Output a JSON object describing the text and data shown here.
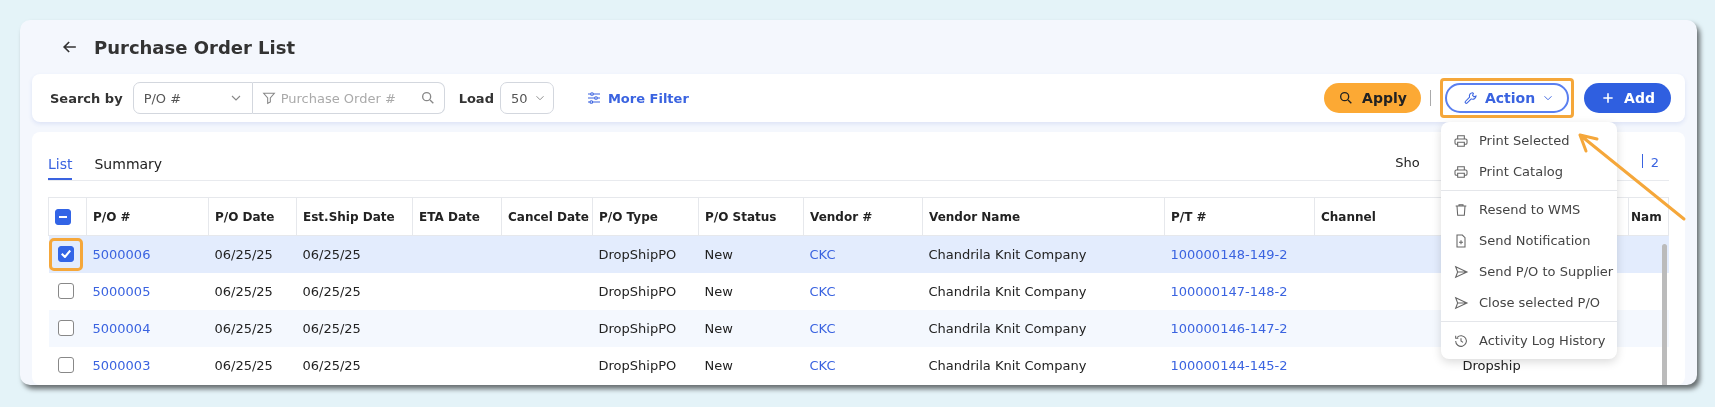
{
  "page": {
    "title": "Purchase Order List"
  },
  "toolbar": {
    "search_by_label": "Search by",
    "search_by": {
      "value": "P/O #"
    },
    "search_input": {
      "placeholder": "Purchase Order #"
    },
    "load_label": "Load",
    "load": {
      "value": "50"
    },
    "more_filter": "More Filter",
    "apply": "Apply",
    "action": {
      "label": "Action",
      "highlighted": true
    },
    "add": "Add"
  },
  "tabs": [
    {
      "label": "List",
      "selected": true
    },
    {
      "label": "Summary",
      "selected": false
    }
  ],
  "pagination": {
    "text": "Sho",
    "page": "2"
  },
  "action_menu": {
    "groups": [
      {
        "items": [
          {
            "kind": "print",
            "label": "Print Selected"
          },
          {
            "kind": "print",
            "label": "Print Catalog"
          }
        ]
      },
      {
        "items": [
          {
            "kind": "trash",
            "label": "Resend to WMS"
          },
          {
            "kind": "file",
            "label": "Send Notification"
          },
          {
            "kind": "send",
            "label": "Send P/O to Supplier"
          },
          {
            "kind": "send",
            "label": "Close selected P/O"
          }
        ]
      },
      {
        "items": [
          {
            "kind": "history",
            "label": "Activity Log History"
          }
        ]
      }
    ]
  },
  "table": {
    "select_all": {
      "checked": true,
      "indeterminate": true
    },
    "columns": [
      "P/O #",
      "P/O Date",
      "Est.Ship Date",
      "ETA Date",
      "Cancel Date",
      "P/O Type",
      "P/O Status",
      "Vendor #",
      "Vendor Name",
      "P/T #",
      "Channel",
      null,
      "Nam"
    ],
    "rows": [
      {
        "checked": true,
        "highlighted": true,
        "cells": [
          "5000006",
          "06/25/25",
          "06/25/25",
          null,
          null,
          "DropShipPO",
          "New",
          "CKC",
          "Chandrila Knit Company",
          "100000148-149-2",
          null,
          null,
          null
        ]
      },
      {
        "checked": false,
        "highlighted": false,
        "cells": [
          "5000005",
          "06/25/25",
          "06/25/25",
          null,
          null,
          "DropShipPO",
          "New",
          "CKC",
          "Chandrila Knit Company",
          "100000147-148-2",
          null,
          null,
          null
        ]
      },
      {
        "checked": false,
        "highlighted": false,
        "cells": [
          "5000004",
          "06/25/25",
          "06/25/25",
          null,
          null,
          "DropShipPO",
          "New",
          "CKC",
          "Chandrila Knit Company",
          "100000146-147-2",
          null,
          null,
          null
        ]
      },
      {
        "checked": false,
        "highlighted": false,
        "cells": [
          "5000003",
          "06/25/25",
          "06/25/25",
          null,
          null,
          "DropShipPO",
          "New",
          "CKC",
          "Chandrila Knit Company",
          "100000144-145-2",
          null,
          "Dropship",
          null
        ]
      }
    ]
  },
  "annotation_arrow": true
}
